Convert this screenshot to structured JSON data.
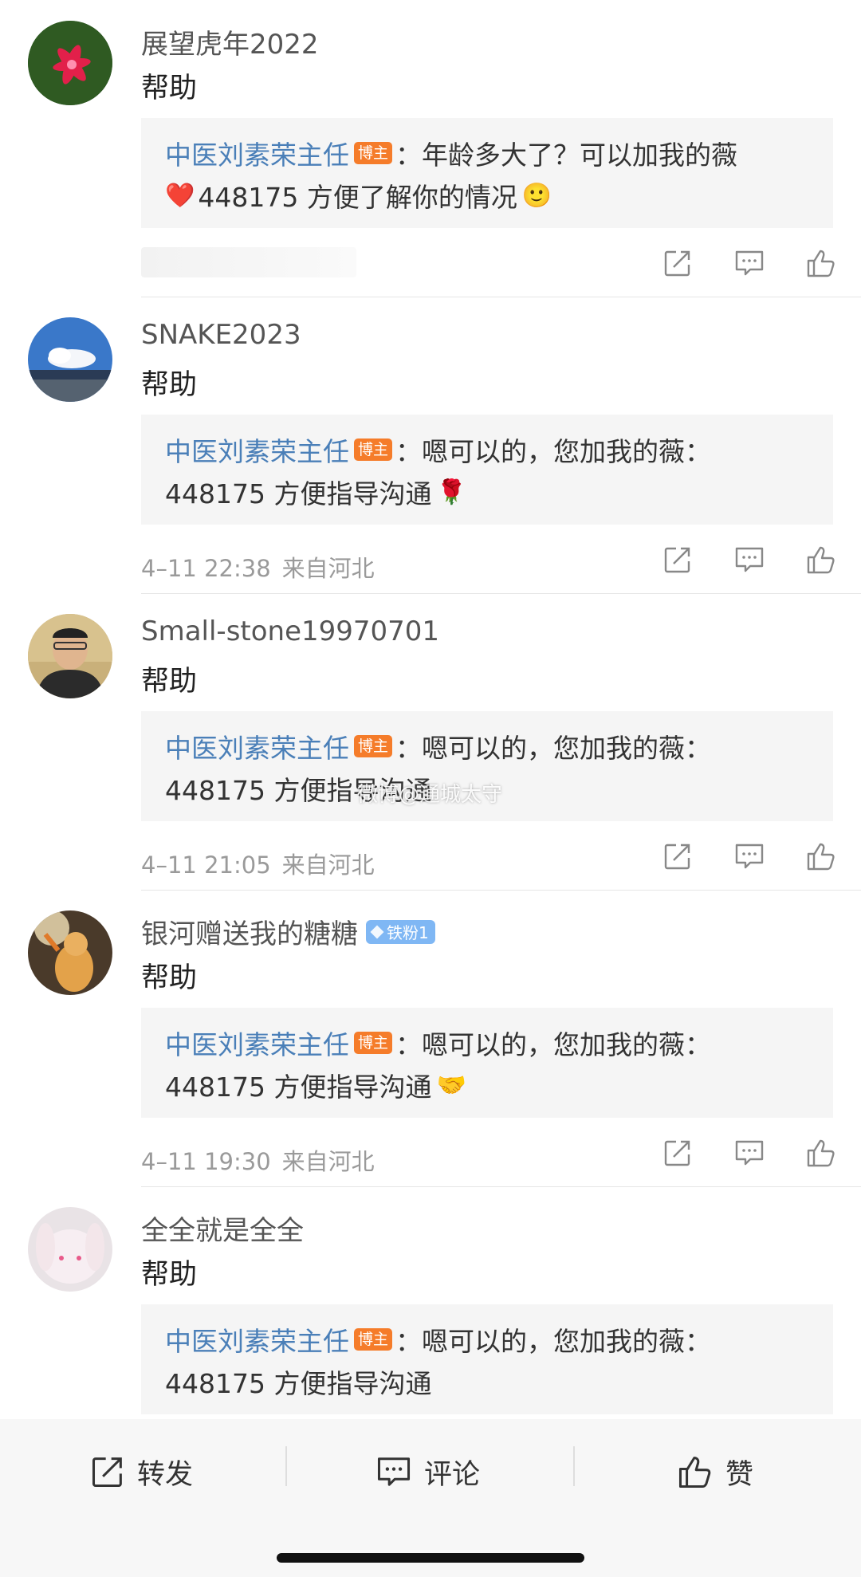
{
  "comments": [
    {
      "username": "展望虎年2022",
      "text": "帮助",
      "reply_author": "中医刘素荣主任",
      "reply_badge": "博主",
      "reply_line1": "：年龄多大了？可以加我的薇",
      "reply_line2": "448175 方便了解你的情况",
      "reply_line2_prefix_emoji": "❤️",
      "reply_emoji": "🙂",
      "time": "",
      "location": ""
    },
    {
      "username": "SNAKE2023",
      "text": "帮助",
      "reply_author": "中医刘素荣主任",
      "reply_badge": "博主",
      "reply_line1": "：嗯可以的，您加我的薇：",
      "reply_line2": "448175 方便指导沟通",
      "reply_emoji": "🌹",
      "time": "4–11 22:38",
      "location": "来自河北"
    },
    {
      "username": "Small-stone19970701",
      "text": "帮助",
      "reply_author": "中医刘素荣主任",
      "reply_badge": "博主",
      "reply_line1": "：嗯可以的，您加我的薇：",
      "reply_line2": "448175 方便指导沟通",
      "reply_emoji": "",
      "time": "4–11 21:05",
      "location": "来自河北"
    },
    {
      "username": "银河赠送我的糖糖",
      "fan_badge": "铁粉1",
      "text": "帮助",
      "reply_author": "中医刘素荣主任",
      "reply_badge": "博主",
      "reply_line1": "：嗯可以的，您加我的薇：",
      "reply_line2": "448175 方便指导沟通",
      "reply_emoji": "🤝",
      "time": "4–11 19:30",
      "location": "来自河北"
    },
    {
      "username": "全全就是全全",
      "text": "帮助",
      "reply_author": "中医刘素荣主任",
      "reply_badge": "博主",
      "reply_line1": "：嗯可以的，您加我的薇：",
      "reply_line2": "448175 方便指导沟通",
      "reply_emoji": "",
      "time": "",
      "location": ""
    }
  ],
  "watermark": "微博@通城太守",
  "bottom_bar": {
    "repost_label": "转发",
    "comment_label": "评论",
    "like_label": "赞"
  },
  "colors": {
    "reply_author": "#4a7fb8",
    "bozhu_badge": "#f57c2a",
    "fan_badge": "#7fb7f4",
    "reply_bg": "#f5f5f5",
    "meta_text": "#9a9a9a"
  }
}
